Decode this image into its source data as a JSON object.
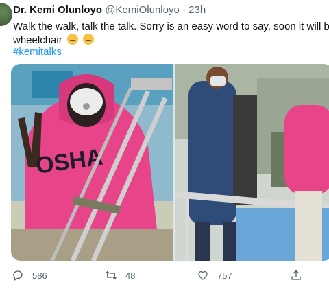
{
  "tweet": {
    "author_name": "Dr. Kemi Olunloyo",
    "handle": "@KemiOlunloyo",
    "separator": "·",
    "time": "23h",
    "text_line1": "Walk the walk, talk the talk. Sorry is an easy word to say, soon it will be",
    "text_line2": "wheelchair",
    "hashtag": "#kemitalks",
    "shirt_text": "OSHA"
  },
  "actions": {
    "replies": "586",
    "retweets": "48",
    "likes": "757"
  },
  "icons": [
    "avatar",
    "emoji-rolling-eyes",
    "emoji-smirk",
    "reply-icon",
    "retweet-icon",
    "like-icon",
    "share-icon"
  ],
  "colors": {
    "link": "#1d9bf0",
    "muted": "#536471",
    "hoodie_pink": "#e8448a"
  }
}
